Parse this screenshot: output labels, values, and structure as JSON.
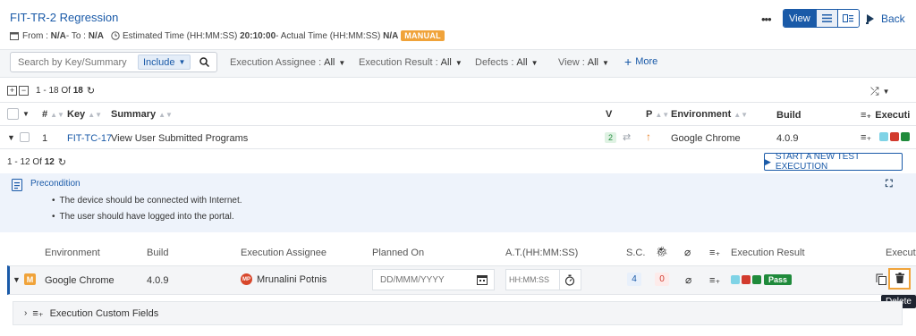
{
  "header": {
    "title": "FIT-TR-2 Regression",
    "from_label": "From :",
    "from_value": "N/A",
    "to_label": " - To :",
    "to_value": "N/A",
    "estimated_label": "Estimated Time (HH:MM:SS)",
    "estimated_value": "20:10:00",
    "actual_label": " - Actual Time (HH:MM:SS)",
    "actual_value": "N/A",
    "mode_badge": "MANUAL",
    "more_label": "•••",
    "view_label": "View",
    "back_label": "Back"
  },
  "filters": {
    "search_placeholder": "Search by Key/Summary",
    "include_label": "Include",
    "execution_assignee_label": "Execution Assignee :",
    "execution_assignee_value": "All",
    "execution_result_label": "Execution Result :",
    "execution_result_value": "All",
    "defects_label": "Defects :",
    "defects_value": "All",
    "view_label": "View :",
    "view_value": "All",
    "more_label": "More"
  },
  "pagination_top": {
    "range": "1 - 18",
    "of_label": "Of",
    "total": "18"
  },
  "table": {
    "headers": {
      "num": "#",
      "key": "Key",
      "summary": "Summary",
      "v": "V",
      "p": "P",
      "environment": "Environment",
      "build": "Build",
      "execution": "Executi"
    },
    "row": {
      "num": "1",
      "key": "FIT-TC-17",
      "summary": "View User Submitted Programs",
      "version": "2",
      "environment": "Google Chrome",
      "build": "4.0.9"
    }
  },
  "executions": {
    "pagination": {
      "range": "1 - 12",
      "of_label": "Of",
      "total": "12"
    },
    "start_button_label": "START A NEW TEST EXECUTION",
    "precondition": {
      "title": "Precondition",
      "items": [
        "The device should be connected with Internet.",
        "The user should have logged into the portal."
      ]
    },
    "columns": {
      "environment": "Environment",
      "build": "Build",
      "assignee": "Execution Assignee",
      "planned_on": "Planned On",
      "actual_time": "A.T.(HH:MM:SS)",
      "sc": "S.C.",
      "result": "Execution Result",
      "exec": "Execut"
    },
    "row": {
      "mode_letter": "M",
      "environment": "Google Chrome",
      "build": "4.0.9",
      "assignee_initials": "MP",
      "assignee": "Mrunalini Potnis",
      "planned_placeholder": "DD/MMM/YYYY",
      "time_placeholder": "HH:MM:SS",
      "sc_count": "4",
      "defect_count": "0",
      "result": "Pass"
    },
    "custom_fields_label": "Execution Custom Fields",
    "delete_tooltip": "Delete"
  },
  "colors": {
    "link": "#1a5aa8",
    "manual_badge": "#f0a33a",
    "pass_green": "#1f8a3b",
    "status_teal": "#7fd3e6",
    "status_red": "#d23b2e",
    "status_green": "#1f8a3b",
    "highlight_orange": "#f0a33a"
  }
}
